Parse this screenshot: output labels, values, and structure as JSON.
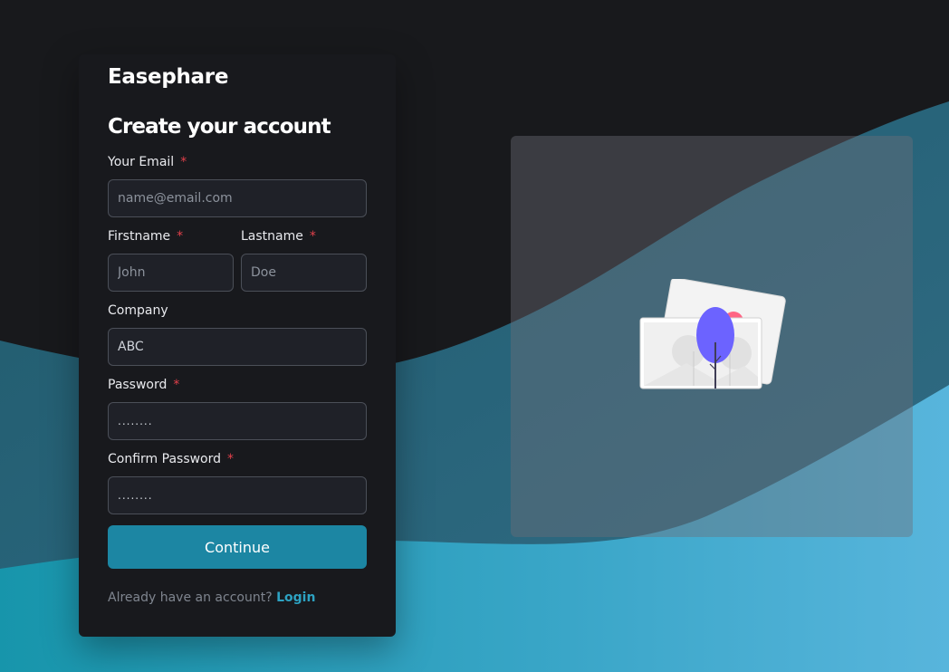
{
  "brand": "Easephare",
  "heading": "Create your account",
  "required_marker": "*",
  "fields": {
    "email": {
      "label": "Your Email",
      "placeholder": "name@email.com",
      "value": ""
    },
    "firstname": {
      "label": "Firstname",
      "placeholder": "John",
      "value": ""
    },
    "lastname": {
      "label": "Lastname",
      "placeholder": "Doe",
      "value": ""
    },
    "company": {
      "label": "Company",
      "placeholder": "ABC",
      "value": "ABC"
    },
    "password": {
      "label": "Password",
      "value": "........"
    },
    "confirm_password": {
      "label": "Confirm Password",
      "value": "........"
    }
  },
  "continue_label": "Continue",
  "login_prompt": "Already have an account?",
  "login_link": "Login",
  "colors": {
    "background": "#18191c",
    "accent": "#1c86a3",
    "link": "#2da2c2",
    "required": "#e2404b",
    "illustration_tree": "#6c63ff",
    "illustration_sun": "#ff6584"
  },
  "icons": {
    "illustration": "photo-gallery-illustration"
  }
}
